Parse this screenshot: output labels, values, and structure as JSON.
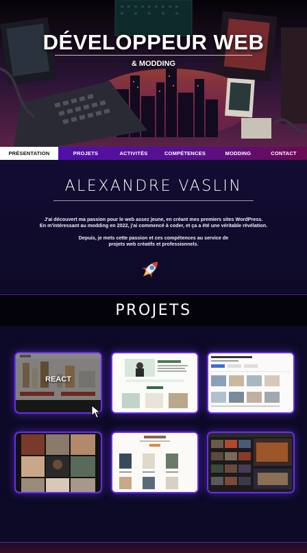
{
  "hero": {
    "title": "DÉVELOPPEUR WEB",
    "subtitle": "& MODDING"
  },
  "nav": {
    "items": [
      {
        "label": "PRÉSENTATION",
        "active": true
      },
      {
        "label": "PROJETS",
        "active": false
      },
      {
        "label": "ACTIVITÉS",
        "active": false
      },
      {
        "label": "COMPÉTENCES",
        "active": false
      },
      {
        "label": "MODDING",
        "active": false
      },
      {
        "label": "CONTACT",
        "active": false
      }
    ]
  },
  "about": {
    "name": "ALEXANDRE VASLIN",
    "paragraph1_line1": "J'ai découvert ma passion pour le web assez jeune, en créant mes premiers sites WordPress.",
    "paragraph1_line2": "En m'intéressant au modding en 2022, j'ai commencé à coder, et ça a été une véritable révélation.",
    "paragraph2_line1": "Depuis, je mets cette passion et ces compétences au service de",
    "paragraph2_line2": "projets web créatifs et professionnels.",
    "icon": "rocket-icon"
  },
  "projects": {
    "title": "PROJETS",
    "cards": [
      {
        "name": "project-card-react",
        "overlay_label": "REACT",
        "hovered": true
      },
      {
        "name": "project-card-portfolio-green",
        "overlay_label": "",
        "hovered": false
      },
      {
        "name": "project-card-real-estate",
        "overlay_label": "",
        "hovered": false
      },
      {
        "name": "project-card-photo-gallery",
        "overlay_label": "",
        "hovered": false
      },
      {
        "name": "project-card-ceramics-shop",
        "overlay_label": "",
        "hovered": false
      },
      {
        "name": "project-card-gaming-dark",
        "overlay_label": "",
        "hovered": false
      }
    ]
  },
  "colors": {
    "background": "#0c0922",
    "nav_gradient_start": "#4a11b5",
    "nav_gradient_end": "#6a0a52",
    "card_border": "#6a2cf0"
  }
}
